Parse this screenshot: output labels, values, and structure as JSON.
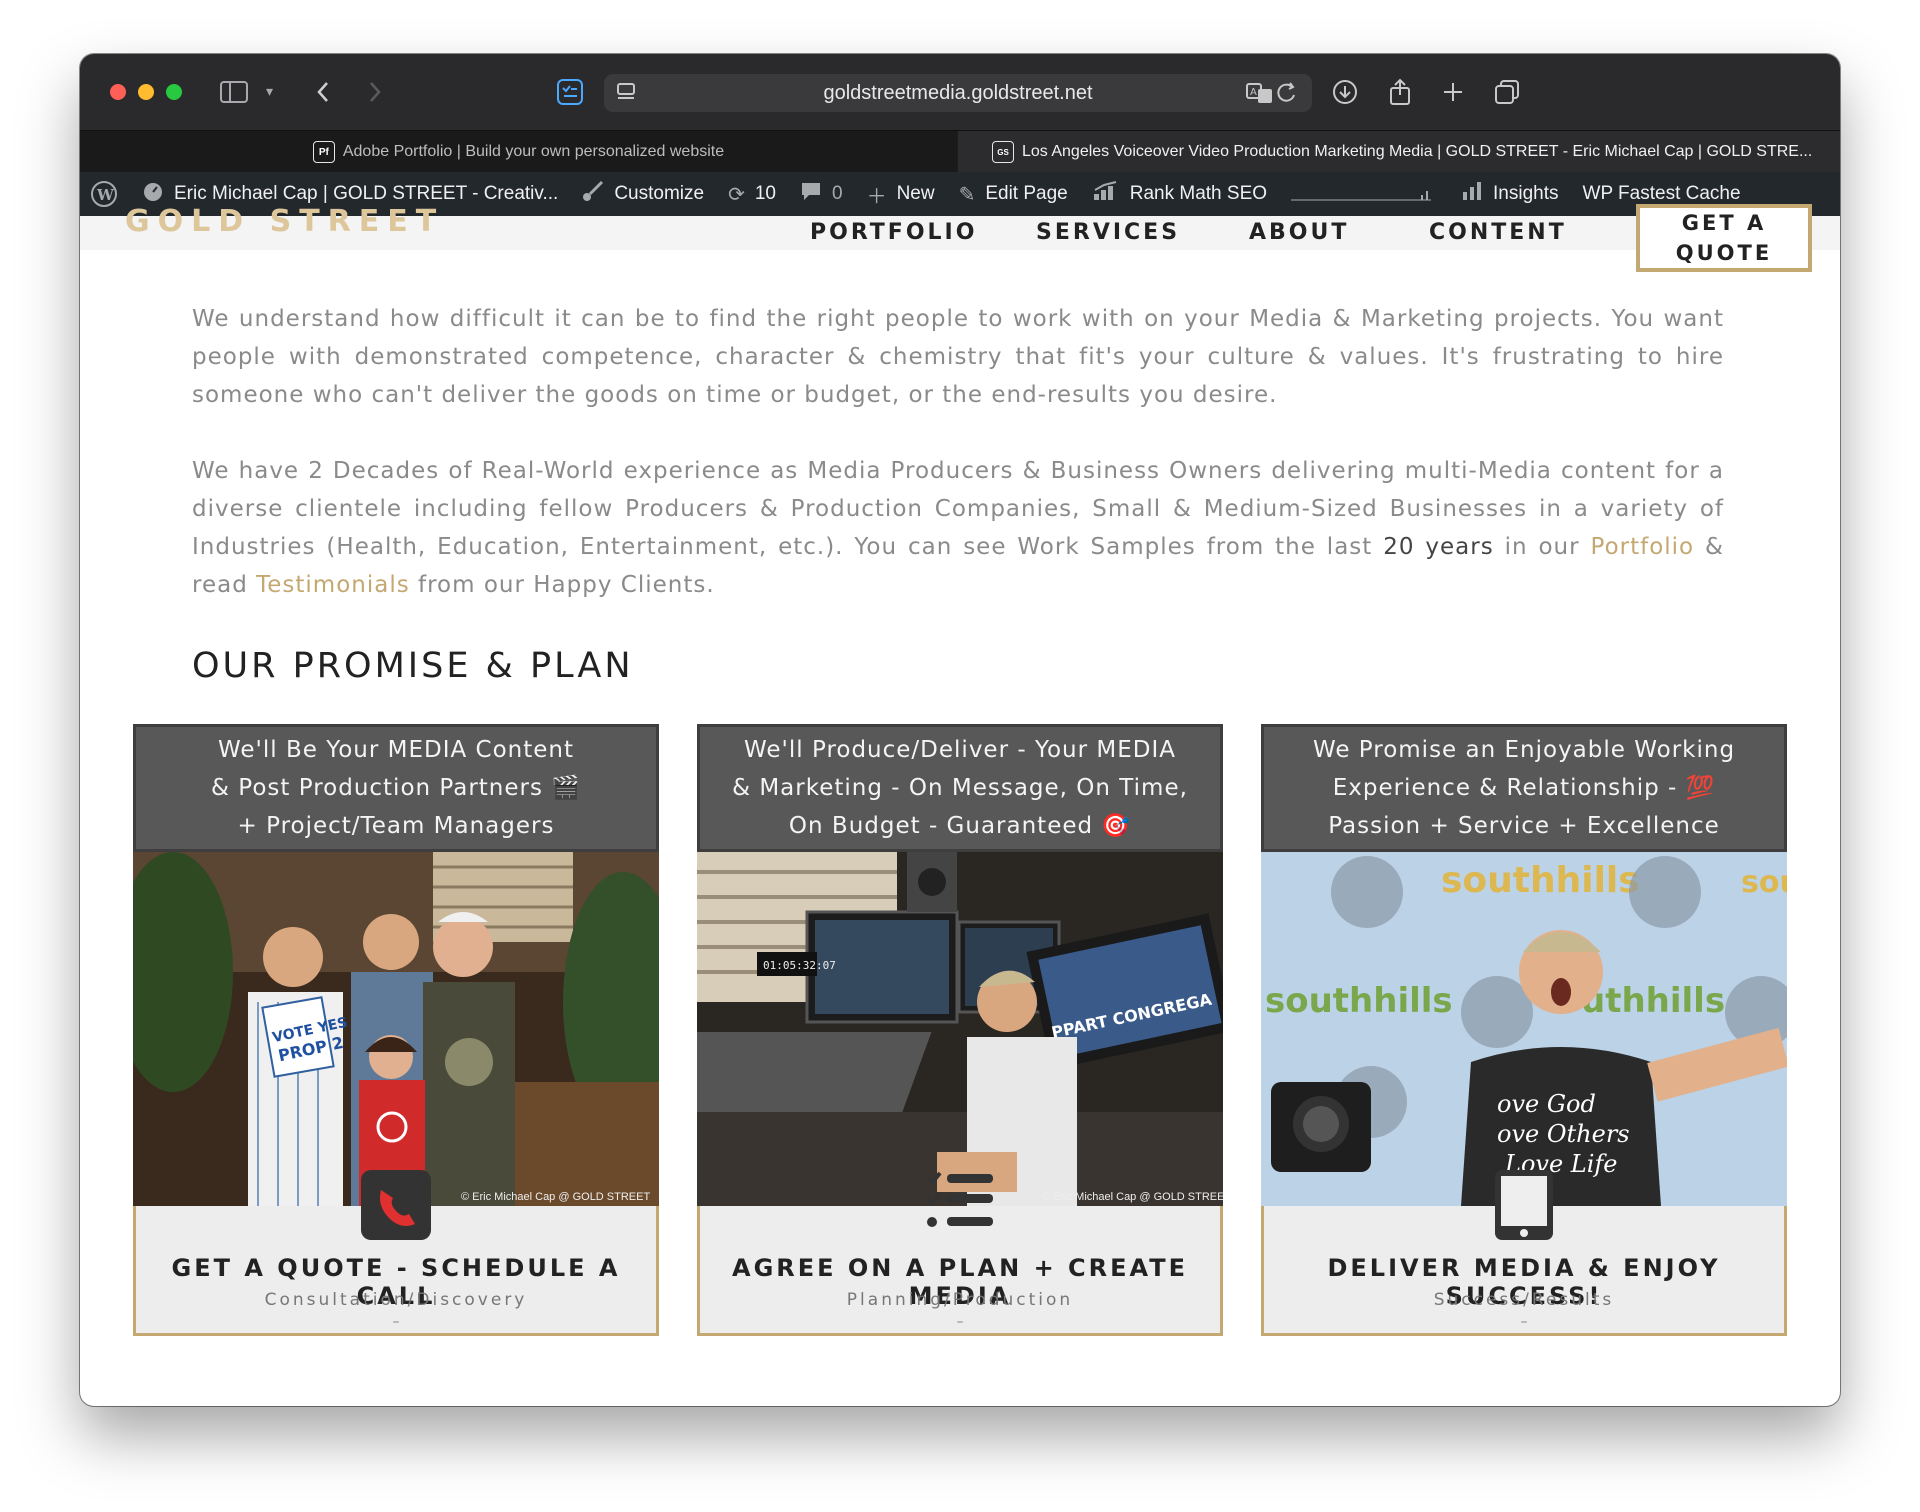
{
  "browser": {
    "url": "goldstreetmedia.goldstreet.net",
    "tabs": [
      {
        "favicon": "Pf",
        "title": "Adobe Portfolio | Build your own personalized website"
      },
      {
        "favicon": "GS",
        "title": "Los Angeles Voiceover Video Production Marketing Media | GOLD STREET - Eric Michael Cap | GOLD STRE..."
      }
    ]
  },
  "adminbar": {
    "site_name": "Eric Michael Cap | GOLD STREET - Creativ...",
    "customize": "Customize",
    "updates_count": "10",
    "comments_count": "0",
    "new_label": "New",
    "edit_page": "Edit Page",
    "rank_math": "Rank Math SEO",
    "insights": "Insights",
    "wp_fastest_cache": "WP Fastest Cache"
  },
  "site_nav": {
    "logo_text": "GOLD STREET",
    "links": [
      "PORTFOLIO",
      "SERVICES",
      "ABOUT",
      "CONTENT"
    ],
    "quote_button": "GET A QUOTE"
  },
  "intro": {
    "p1": "We understand how difficult it can be to find the right people to work with on your Media & Marketing projects. You want people with demonstrated competence, character & chemistry that fit's your culture & values. It's frustrating to hire someone who can't deliver the goods on time or budget, or the end-results you desire.",
    "p2_a": "We have 2 Decades of Real-World experience as Media Producers & Business Owners delivering multi-Media content for a diverse clientele including fellow Producers & Production Companies, Small & Medium-Sized Businesses in a variety of Industries (Health, Education, Entertainment, etc.). You can see Work Samples from the last ",
    "p2_em": "20 years",
    "p2_b": " in our ",
    "p2_link1": "Portfolio",
    "p2_c": " & read ",
    "p2_link2": "Testimonials",
    "p2_d": " from our Happy Clients."
  },
  "section_title": "OUR PROMISE & PLAN",
  "cards": [
    {
      "head_lines": [
        "We'll Be Your MEDIA Content",
        "& Post Production Partners 🎬",
        "+ Project/Team Managers"
      ],
      "icon": "phone-icon",
      "title": "GET A QUOTE - SCHEDULE A CALL",
      "subtitle": "Consultation/Discovery",
      "dash": "–",
      "watermark": "© Eric Michael Cap @ GOLD STREET"
    },
    {
      "head_lines": [
        "We'll Produce/Deliver - Your MEDIA",
        "& Marketing - On Message, On Time,",
        "On Budget - Guaranteed 🎯"
      ],
      "icon": "checklist-icon",
      "title": "AGREE ON A PLAN + CREATE MEDIA",
      "subtitle": "Planning/Production",
      "dash": "–",
      "watermark": "© Eric Michael Cap @ GOLD STREET"
    },
    {
      "head_lines": [
        "We Promise an Enjoyable Working",
        "Experience & Relationship - 💯",
        "Passion + Service + Excellence"
      ],
      "icon": "tablet-icon",
      "title": "DELIVER MEDIA & ENJOY SUCCESS!",
      "subtitle": "Success/Results",
      "dash": "–",
      "watermark": ""
    }
  ],
  "colors": {
    "accent_gold": "#c4a872",
    "card_head_bg": "#585858",
    "admin_bar_bg": "#23282d"
  }
}
